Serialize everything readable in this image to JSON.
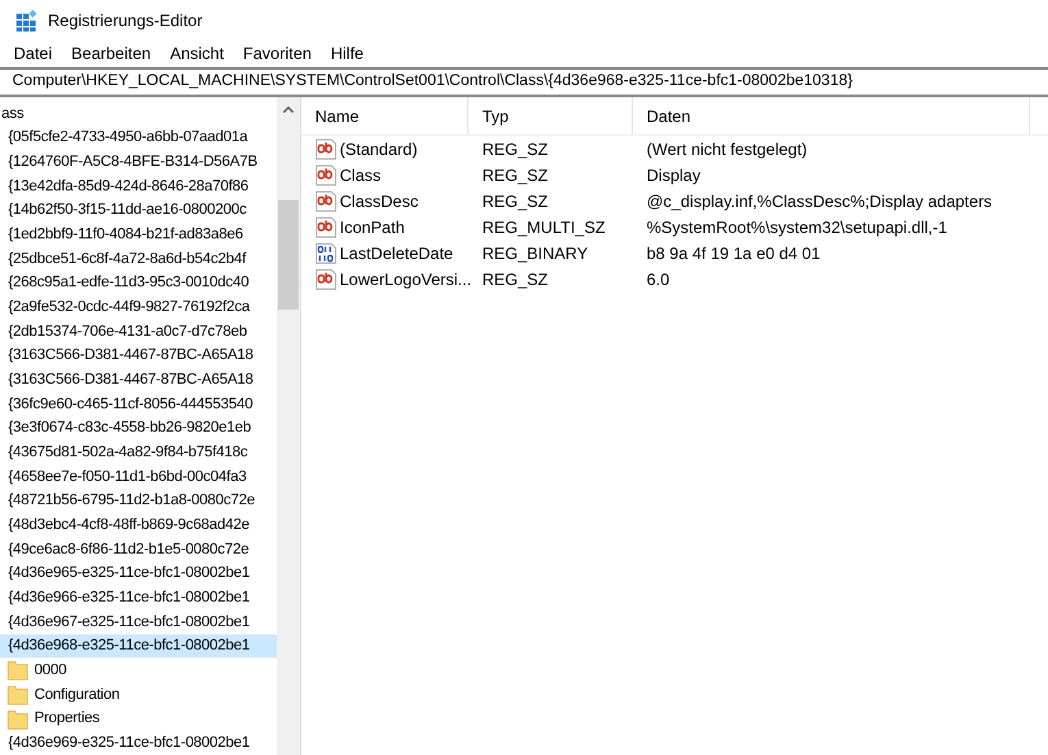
{
  "window": {
    "title": "Registrierungs-Editor"
  },
  "menu": [
    "Datei",
    "Bearbeiten",
    "Ansicht",
    "Favoriten",
    "Hilfe"
  ],
  "address": "Computer\\HKEY_LOCAL_MACHINE\\SYSTEM\\ControlSet001\\Control\\Class\\{4d36e968-e325-11ce-bfc1-08002be10318}",
  "tree": {
    "parent": "ass",
    "items": [
      {
        "label": "{05f5cfe2-4733-4950-a6bb-07aad01a",
        "selected": false
      },
      {
        "label": "{1264760F-A5C8-4BFE-B314-D56A7B",
        "selected": false
      },
      {
        "label": "{13e42dfa-85d9-424d-8646-28a70f86",
        "selected": false
      },
      {
        "label": "{14b62f50-3f15-11dd-ae16-0800200c",
        "selected": false
      },
      {
        "label": "{1ed2bbf9-11f0-4084-b21f-ad83a8e6",
        "selected": false
      },
      {
        "label": "{25dbce51-6c8f-4a72-8a6d-b54c2b4f",
        "selected": false
      },
      {
        "label": "{268c95a1-edfe-11d3-95c3-0010dc40",
        "selected": false
      },
      {
        "label": "{2a9fe532-0cdc-44f9-9827-76192f2ca",
        "selected": false
      },
      {
        "label": "{2db15374-706e-4131-a0c7-d7c78eb",
        "selected": false
      },
      {
        "label": "{3163C566-D381-4467-87BC-A65A18",
        "selected": false
      },
      {
        "label": "{3163C566-D381-4467-87BC-A65A18",
        "selected": false
      },
      {
        "label": "{36fc9e60-c465-11cf-8056-444553540",
        "selected": false
      },
      {
        "label": "{3e3f0674-c83c-4558-bb26-9820e1eb",
        "selected": false
      },
      {
        "label": "{43675d81-502a-4a82-9f84-b75f418c",
        "selected": false
      },
      {
        "label": "{4658ee7e-f050-11d1-b6bd-00c04fa3",
        "selected": false
      },
      {
        "label": "{48721b56-6795-11d2-b1a8-0080c72e",
        "selected": false
      },
      {
        "label": "{48d3ebc4-4cf8-48ff-b869-9c68ad42e",
        "selected": false
      },
      {
        "label": "{49ce6ac8-6f86-11d2-b1e5-0080c72e",
        "selected": false
      },
      {
        "label": "{4d36e965-e325-11ce-bfc1-08002be1",
        "selected": false
      },
      {
        "label": "{4d36e966-e325-11ce-bfc1-08002be1",
        "selected": false
      },
      {
        "label": "{4d36e967-e325-11ce-bfc1-08002be1",
        "selected": false
      },
      {
        "label": "{4d36e968-e325-11ce-bfc1-08002be1",
        "selected": true,
        "children": [
          {
            "label": "0000",
            "selected": false
          },
          {
            "label": "Configuration",
            "selected": false
          },
          {
            "label": "Properties",
            "selected": false
          }
        ]
      },
      {
        "label": "{4d36e969-e325-11ce-bfc1-08002be1",
        "selected": false
      }
    ]
  },
  "table": {
    "columns": [
      "Name",
      "Typ",
      "Daten"
    ],
    "rows": [
      {
        "kind": "string",
        "name": "(Standard)",
        "type": "REG_SZ",
        "data": "(Wert nicht festgelegt)"
      },
      {
        "kind": "string",
        "name": "Class",
        "type": "REG_SZ",
        "data": "Display"
      },
      {
        "kind": "string",
        "name": "ClassDesc",
        "type": "REG_SZ",
        "data": "@c_display.inf,%ClassDesc%;Display adapters"
      },
      {
        "kind": "string",
        "name": "IconPath",
        "type": "REG_MULTI_SZ",
        "data": "%SystemRoot%\\system32\\setupapi.dll,-1"
      },
      {
        "kind": "binary",
        "name": "LastDeleteDate",
        "type": "REG_BINARY",
        "data": "b8 9a 4f 19 1a e0 d4 01"
      },
      {
        "kind": "string",
        "name": "LowerLogoVersi...",
        "type": "REG_SZ",
        "data": "6.0"
      }
    ]
  }
}
